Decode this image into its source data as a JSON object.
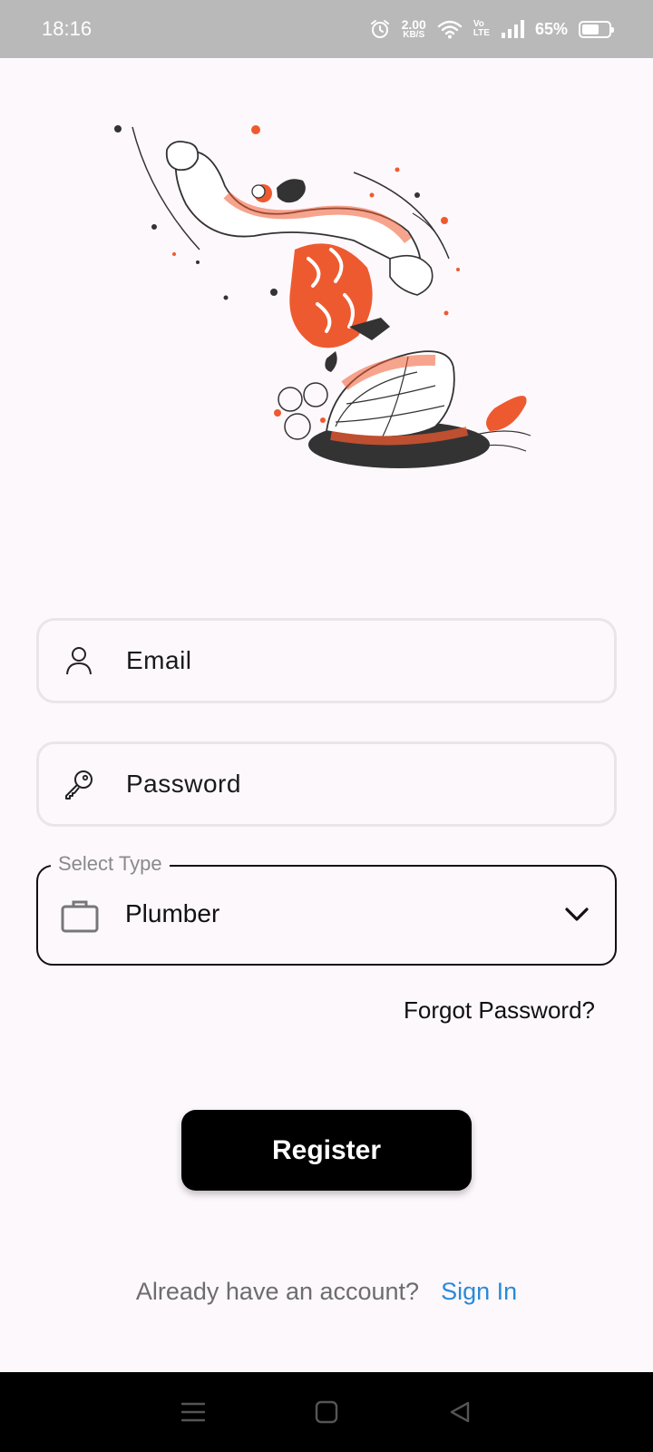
{
  "status_bar": {
    "time": "18:16",
    "speed_value": "2.00",
    "speed_unit": "KB/S",
    "volte_top": "Vo",
    "volte_bottom": "LTE",
    "battery_percent": "65%",
    "battery_level": 0.65
  },
  "form": {
    "email_label": "Email",
    "password_label": "Password",
    "type_legend": "Select Type",
    "type_value": "Plumber",
    "forgot_label": "Forgot Password?",
    "register_label": "Register"
  },
  "footer": {
    "prompt": "Already have an account?",
    "signin_label": "Sign In"
  },
  "colors": {
    "accent": "#2a8ad9",
    "illustration_orange": "#ee5a30",
    "background": "#fdf8fc",
    "button": "#000000"
  },
  "icons": {
    "email": "person-icon",
    "password": "key-icon",
    "type": "briefcase-icon",
    "dropdown": "chevron-down-icon"
  }
}
